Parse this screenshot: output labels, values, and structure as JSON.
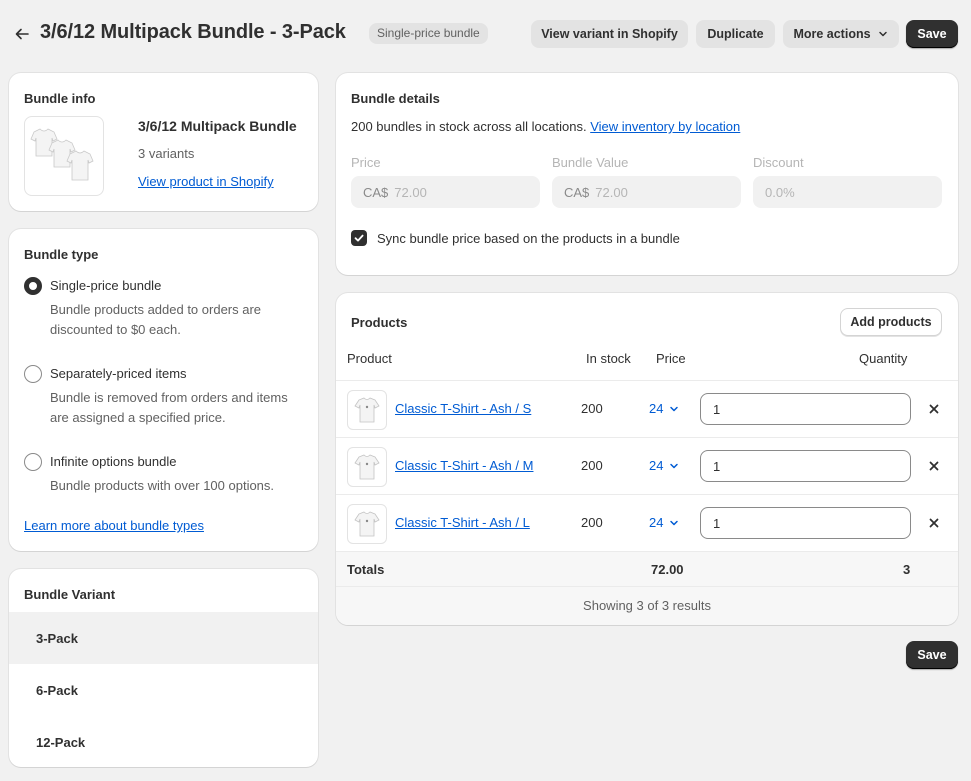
{
  "header": {
    "title": "3/6/12 Multipack Bundle - 3-Pack",
    "badge": "Single-price bundle",
    "view_variant_label": "View variant in Shopify",
    "duplicate_label": "Duplicate",
    "more_actions_label": "More actions",
    "save_label": "Save"
  },
  "bundle_info": {
    "heading": "Bundle info",
    "product_name": "3/6/12 Multipack Bundle",
    "variants": "3 variants",
    "view_product_link": "View product in Shopify"
  },
  "bundle_type": {
    "heading": "Bundle type",
    "options": [
      {
        "label": "Single-price bundle",
        "description": "Bundle products added to orders are discounted to $0 each.",
        "selected": true
      },
      {
        "label": "Separately-priced items",
        "description": "Bundle is removed from orders and items are assigned a specified price.",
        "selected": false
      },
      {
        "label": "Infinite options bundle",
        "description": "Bundle products with over 100 options.",
        "selected": false
      }
    ],
    "learn_more_link": "Learn more about bundle types"
  },
  "bundle_variant": {
    "heading": "Bundle Variant",
    "items": [
      "3-Pack",
      "6-Pack",
      "12-Pack"
    ],
    "selected": "3-Pack"
  },
  "bundle_details": {
    "heading": "Bundle details",
    "stock_text": "200 bundles in stock across all locations.",
    "inventory_link": "View inventory by location",
    "price_label": "Price",
    "price_currency": "CA$",
    "price_value": "72.00",
    "bundle_value_label": "Bundle Value",
    "bundle_value_currency": "CA$",
    "bundle_value_value": "72.00",
    "discount_label": "Discount",
    "discount_value": "0.0%",
    "sync_label": "Sync bundle price based on the products in a bundle",
    "sync_checked": true
  },
  "products": {
    "heading": "Products",
    "add_button": "Add products",
    "columns": {
      "product": "Product",
      "in_stock": "In stock",
      "price": "Price",
      "quantity": "Quantity"
    },
    "rows": [
      {
        "name": "Classic T-Shirt - Ash / S",
        "stock": "200",
        "price": "24",
        "quantity": "1"
      },
      {
        "name": "Classic T-Shirt - Ash / M",
        "stock": "200",
        "price": "24",
        "quantity": "1"
      },
      {
        "name": "Classic T-Shirt - Ash / L",
        "stock": "200",
        "price": "24",
        "quantity": "1"
      }
    ],
    "totals_label": "Totals",
    "totals_price": "72.00",
    "totals_quantity": "3",
    "results_text": "Showing 3 of 3 results"
  },
  "footer": {
    "save_label": "Save"
  },
  "colors": {
    "accent": "#303030",
    "link": "#005bd3",
    "background": "#f1f1f1"
  },
  "icons": [
    "arrow-left-icon",
    "chevron-down-icon",
    "checkmark-icon",
    "close-icon",
    "tshirt-icon"
  ]
}
